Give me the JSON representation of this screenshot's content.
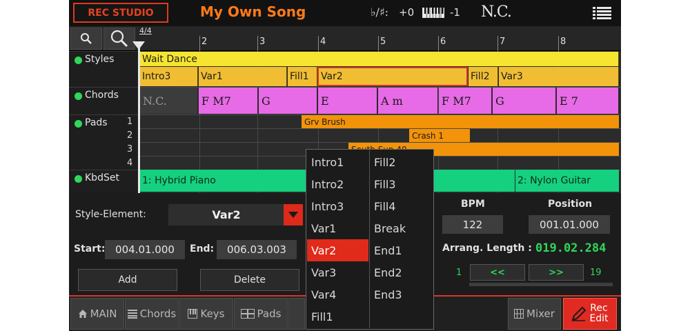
{
  "header": {
    "mode_button": "REC STUDIO",
    "song_title": "My Own Song",
    "transpose_symbol": "♭/♯:",
    "transpose_value": "+0",
    "octave_value": "-1",
    "chord_display": "N.C."
  },
  "ruler": {
    "time_signature": "4/4",
    "bars": [
      "2",
      "3",
      "4",
      "5",
      "6",
      "7",
      "8"
    ]
  },
  "tracks": {
    "styles_label": "Styles",
    "chords_label": "Chords",
    "pads_label": "Pads",
    "pad_numbers": [
      "1",
      "2",
      "3",
      "4"
    ],
    "kbdset_label": "KbdSet",
    "style_main": "Wait Dance",
    "style_elements": [
      "Intro3",
      "Var1",
      "Fill1",
      "Var2",
      "Fill2",
      "Var3"
    ],
    "chords": [
      "N.C.",
      "F M7",
      "G",
      "E",
      "A m",
      "F M7",
      "G",
      "E 7"
    ],
    "pads": [
      "Grv Brush",
      "Crash 1",
      "South Sun 40"
    ],
    "kbdsets": [
      "1: Hybrid Piano",
      "2: Nylon Guitar"
    ]
  },
  "editor": {
    "style_element_label": "Style-Element:",
    "style_element_value": "Var2",
    "start_label": "Start:",
    "start_value": "004.01.000",
    "end_label": "End:",
    "end_value": "006.03.003",
    "add_button": "Add",
    "delete_button": "Delete",
    "bpm_label": "BPM",
    "bpm_value": "122",
    "position_label": "Position",
    "position_value": "001.01.000",
    "arr_length_label": "Arrang. Length :",
    "arr_length_value": "019.02.284",
    "nav_start": "1",
    "nav_prev": "<<",
    "nav_next": ">>",
    "nav_end": "19"
  },
  "dropdown": {
    "col1": [
      "Intro1",
      "Intro2",
      "Intro3",
      "Var1",
      "Var2",
      "Var3",
      "Var4",
      "Fill1"
    ],
    "col2": [
      "Fill2",
      "Fill3",
      "Fill4",
      "Break",
      "End1",
      "End2",
      "End3"
    ],
    "selected": "Var2"
  },
  "tabs": {
    "main": "MAIN",
    "chords": "Chords",
    "keys": "Keys",
    "pads": "Pads",
    "mixer": "Mixer",
    "rec_edit_line1": "Rec",
    "rec_edit_line2": "Edit"
  },
  "colors": {
    "accent_red": "#e02a1a",
    "title_orange": "#ff7a18",
    "style_yellow": "#f6e530",
    "style_element_amber": "#f1be33",
    "chord_magenta": "#e76ae6",
    "pad_orange": "#f2930a",
    "kbdset_green": "#14d07f",
    "value_green": "#2fd85a"
  }
}
